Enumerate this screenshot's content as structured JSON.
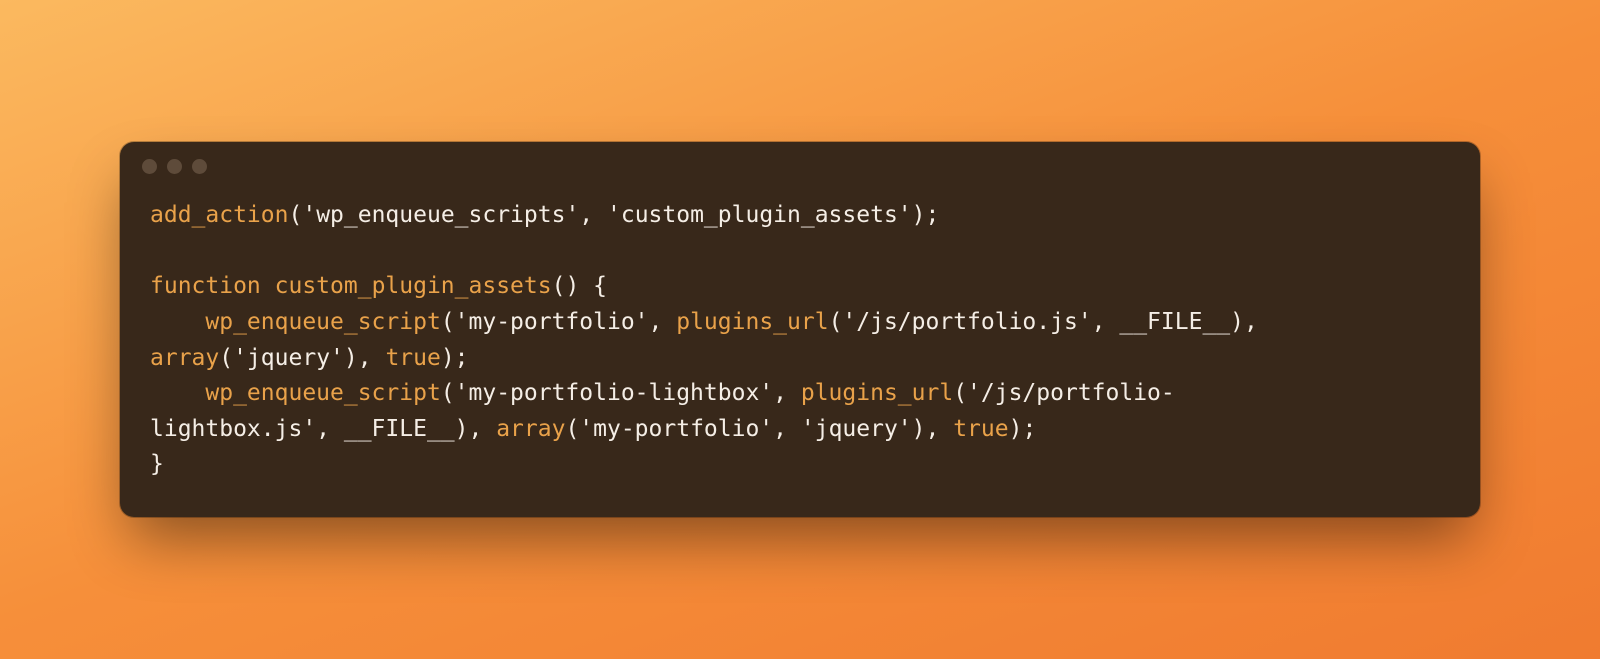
{
  "code": {
    "tokens": [
      {
        "c": "k",
        "t": "add_action"
      },
      {
        "c": "s",
        "t": "("
      },
      {
        "c": "s",
        "t": "'wp_enqueue_scripts'"
      },
      {
        "c": "s",
        "t": ", "
      },
      {
        "c": "s",
        "t": "'custom_plugin_assets'"
      },
      {
        "c": "s",
        "t": ");"
      },
      {
        "br": 2
      },
      {
        "c": "k",
        "t": "function"
      },
      {
        "c": "s",
        "t": " "
      },
      {
        "c": "k",
        "t": "custom_plugin_assets"
      },
      {
        "c": "s",
        "t": "() {"
      },
      {
        "br": 1
      },
      {
        "c": "s",
        "t": "    "
      },
      {
        "c": "k",
        "t": "wp_enqueue_script"
      },
      {
        "c": "s",
        "t": "("
      },
      {
        "c": "s",
        "t": "'my-portfolio'"
      },
      {
        "c": "s",
        "t": ", "
      },
      {
        "c": "k",
        "t": "plugins_url"
      },
      {
        "c": "s",
        "t": "("
      },
      {
        "c": "s",
        "t": "'/js/portfolio.js'"
      },
      {
        "c": "s",
        "t": ", __FILE__), "
      },
      {
        "br": 1
      },
      {
        "c": "k",
        "t": "array"
      },
      {
        "c": "s",
        "t": "("
      },
      {
        "c": "s",
        "t": "'jquery'"
      },
      {
        "c": "s",
        "t": "), "
      },
      {
        "c": "k",
        "t": "true"
      },
      {
        "c": "s",
        "t": ");"
      },
      {
        "br": 1
      },
      {
        "c": "s",
        "t": "    "
      },
      {
        "c": "k",
        "t": "wp_enqueue_script"
      },
      {
        "c": "s",
        "t": "("
      },
      {
        "c": "s",
        "t": "'my-portfolio-lightbox'"
      },
      {
        "c": "s",
        "t": ", "
      },
      {
        "c": "k",
        "t": "plugins_url"
      },
      {
        "c": "s",
        "t": "("
      },
      {
        "c": "s",
        "t": "'/js/portfolio-"
      },
      {
        "br": 1
      },
      {
        "c": "s",
        "t": "lightbox.js'"
      },
      {
        "c": "s",
        "t": ", __FILE__), "
      },
      {
        "c": "k",
        "t": "array"
      },
      {
        "c": "s",
        "t": "("
      },
      {
        "c": "s",
        "t": "'my-portfolio'"
      },
      {
        "c": "s",
        "t": ", "
      },
      {
        "c": "s",
        "t": "'jquery'"
      },
      {
        "c": "s",
        "t": "), "
      },
      {
        "c": "k",
        "t": "true"
      },
      {
        "c": "s",
        "t": ");"
      },
      {
        "br": 1
      },
      {
        "c": "s",
        "t": "}"
      }
    ]
  }
}
